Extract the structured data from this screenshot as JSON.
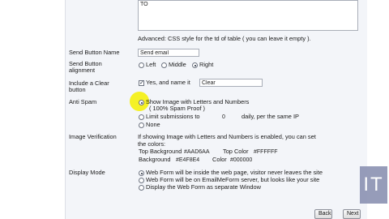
{
  "top_field": {
    "value": "TO"
  },
  "advanced_note": "Advanced: CSS style for the td of table ( you can leave it empty ).",
  "send_button_name": {
    "label": "Send Button Name",
    "value": "Send email"
  },
  "send_button_alignment": {
    "label_line1": "Send Button",
    "label_line2": "alignment",
    "options": [
      "Left",
      "Middle",
      "Right"
    ],
    "selected": "Right"
  },
  "clear_button": {
    "label_line1": "Include a Clear",
    "label_line2": "button",
    "checkbox_label": "Yes, and name it",
    "value": "Clear",
    "checked": true
  },
  "anti_spam": {
    "label": "Anti Spam",
    "option1_line1": "Show Image with Letters and Numbers",
    "option1_line2": "( 100% Spam Proof )",
    "option2_prefix": "Limit submissions to",
    "option2_value": "0",
    "option2_suffix": "daily, per the same IP",
    "option3": "None",
    "selected": "Show Image with Letters and Numbers"
  },
  "image_verification": {
    "label": "Image Verification",
    "line1": "If showing Image with Letters and Numbers is enabled, you can set",
    "line2": "the colors:",
    "top_bg_label": "Top Background",
    "top_bg_value": "#AAD6AA",
    "top_color_label": "Top Color",
    "top_color_value": "#FFFFFF",
    "bg_label": "Background",
    "bg_value": "#E4F8E4",
    "color_label": "Color",
    "color_value": "#000000"
  },
  "display_mode": {
    "label": "Display Mode",
    "options": [
      "Web Form will be inside the web page, visitor never leaves the site",
      "Web Form will be on EmailMeForm server, but looks like your site",
      "Display the Web Form as separate Window"
    ],
    "selected": "Web Form will be inside the web page, visitor never leaves the site"
  },
  "nav": {
    "back": "Back",
    "next": "Next"
  },
  "logo_text": "IT",
  "colors": {
    "panel": "#f3f5f9",
    "highlight": "#f4f000",
    "logo": "#8e94b4"
  }
}
